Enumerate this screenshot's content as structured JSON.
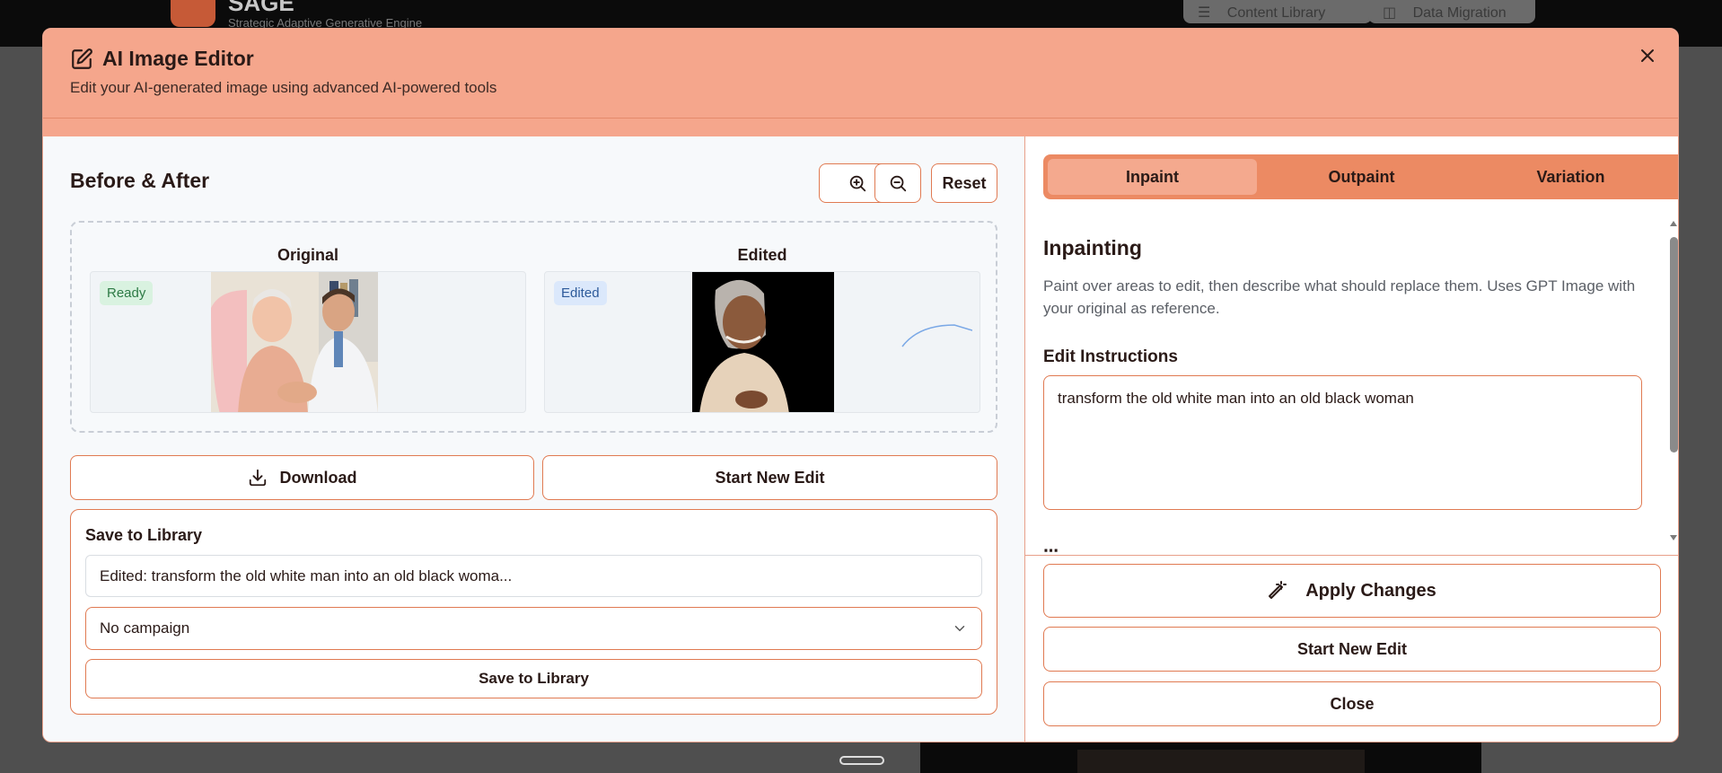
{
  "background": {
    "brand": "SAGE",
    "tagline": "Strategic Adaptive Generative Engine",
    "nav": [
      {
        "label": "Content Library",
        "icon": "library-icon"
      },
      {
        "label": "Data Migration",
        "icon": "database-icon"
      }
    ]
  },
  "modal": {
    "title": "AI Image Editor",
    "subtitle": "Edit your AI-generated image using advanced AI-powered tools",
    "close_icon": "close-icon"
  },
  "compare": {
    "title": "Before & After",
    "zoom_in_icon": "zoom-in-icon",
    "zoom_out_icon": "zoom-out-icon",
    "reset_label": "Reset",
    "original_label": "Original",
    "edited_label": "Edited",
    "original_badge": "Ready",
    "edited_badge": "Edited"
  },
  "actions": {
    "download_label": "Download",
    "start_new_label": "Start New Edit"
  },
  "save": {
    "title": "Save to Library",
    "name_value": "Edited: transform the old white man into an old black woma...",
    "campaign_value": "No campaign",
    "save_button": "Save to Library"
  },
  "tabs": [
    {
      "label": "Inpaint",
      "active": true
    },
    {
      "label": "Outpaint",
      "active": false
    },
    {
      "label": "Variation",
      "active": false
    }
  ],
  "inpaint": {
    "title": "Inpainting",
    "description": "Paint over areas to edit, then describe what should replace them. Uses GPT Image with your original as reference.",
    "instructions_label": "Edit Instructions",
    "instructions_value": "transform the old white man into an old black woman"
  },
  "footer": {
    "apply_label": "Apply Changes",
    "start_new_label": "Start New Edit",
    "close_label": "Close"
  },
  "colors": {
    "header_bg": "#f5a68c",
    "accent": "#e07a52",
    "tabs_bg": "#ec8a63",
    "active_tab": "#f4a98e"
  }
}
